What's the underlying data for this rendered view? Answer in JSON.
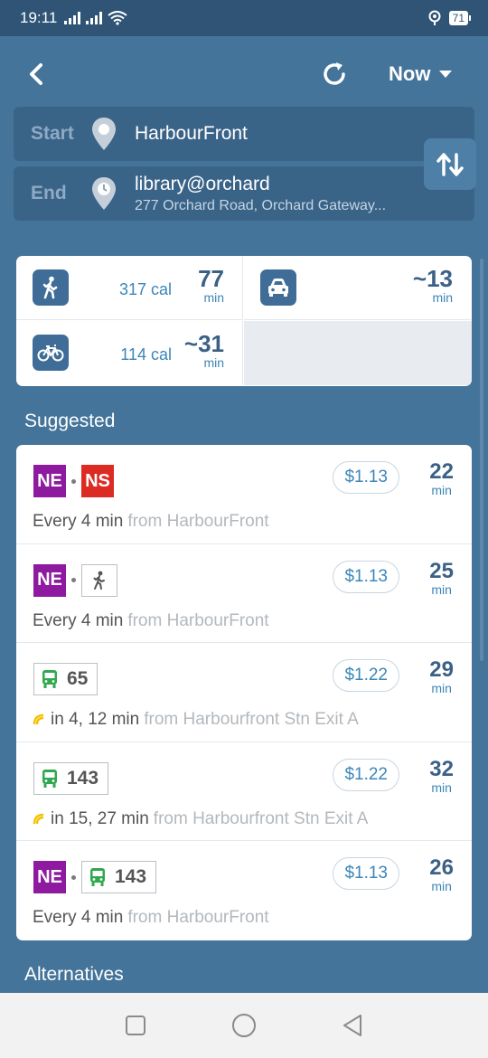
{
  "status_bar": {
    "time": "19:11",
    "battery": "71"
  },
  "header": {
    "time_selector": "Now"
  },
  "trip": {
    "start_label": "Start",
    "start_value": "HarbourFront",
    "end_label": "End",
    "end_value": "library@orchard",
    "end_address": "277 Orchard Road, Orchard Gateway..."
  },
  "modes": {
    "walk": {
      "calories": "317 cal",
      "duration": "77",
      "unit": "min"
    },
    "taxi": {
      "duration": "~13",
      "unit": "min"
    },
    "bike": {
      "calories": "114 cal",
      "duration": "~31",
      "unit": "min"
    }
  },
  "suggested_title": "Suggested",
  "routes": [
    {
      "badge1": "NE",
      "badge2": "NS",
      "fare": "$1.13",
      "duration": "22",
      "unit": "min",
      "freq": "Every 4 min",
      "from": "from HarbourFront"
    },
    {
      "badge1": "NE",
      "fare": "$1.13",
      "duration": "25",
      "unit": "min",
      "freq": "Every 4 min",
      "from": "from HarbourFront"
    },
    {
      "bus": "65",
      "fare": "$1.22",
      "duration": "29",
      "unit": "min",
      "freq": "in 4, 12 min",
      "from": "from Harbourfront Stn Exit A"
    },
    {
      "bus": "143",
      "fare": "$1.22",
      "duration": "32",
      "unit": "min",
      "freq": "in 15, 27 min",
      "from": "from Harbourfront Stn Exit A"
    },
    {
      "badge1": "NE",
      "bus": "143",
      "fare": "$1.13",
      "duration": "26",
      "unit": "min",
      "freq": "Every 4 min",
      "from": "from HarbourFront"
    }
  ],
  "alternatives_title": "Alternatives",
  "colors": {
    "background": "#44749a",
    "ne_line": "#8e1aa0",
    "ns_line": "#dc2b22",
    "accent": "#3b86b8",
    "bus_icon": "#2fa84f"
  }
}
